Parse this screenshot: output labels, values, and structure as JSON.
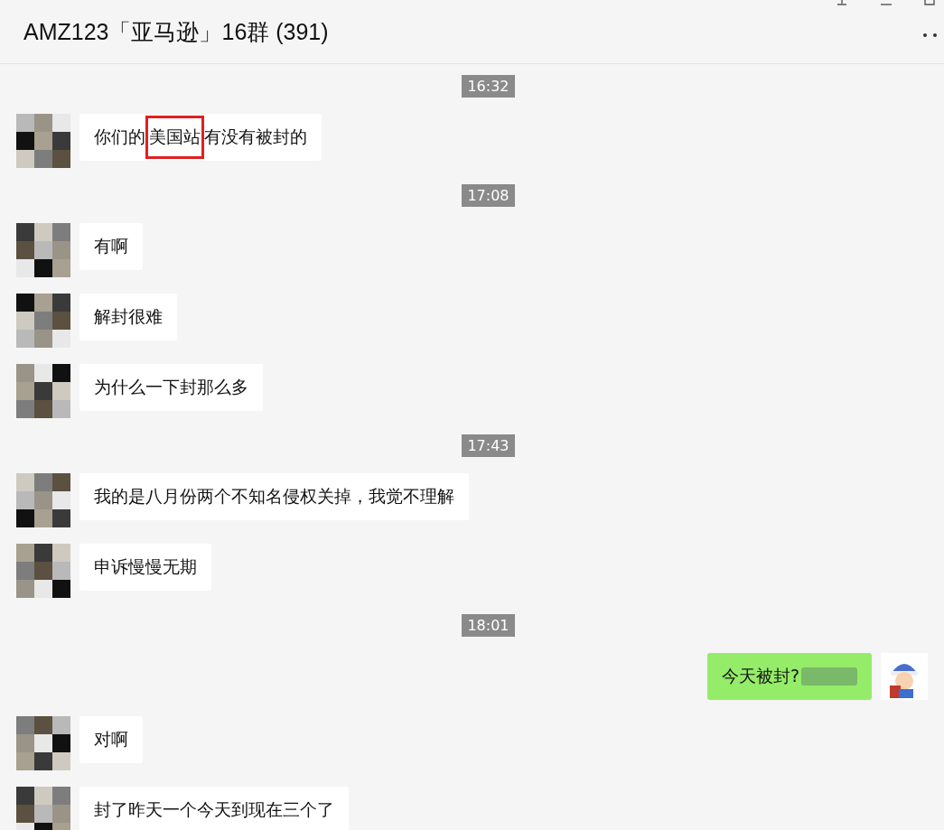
{
  "window": {
    "title": "AMZ123「亚马逊」16群 (391)"
  },
  "messages": [
    {
      "kind": "time",
      "text": "16:32"
    },
    {
      "kind": "message",
      "outgoing": false,
      "parts": [
        {
          "text": "你们的",
          "highlighted": false
        },
        {
          "text": "美国站",
          "highlighted": true
        },
        {
          "text": "有没有被封的",
          "highlighted": false
        }
      ]
    },
    {
      "kind": "time",
      "text": "17:08"
    },
    {
      "kind": "message",
      "outgoing": false,
      "parts": [
        {
          "text": "有啊",
          "highlighted": false
        }
      ]
    },
    {
      "kind": "message",
      "outgoing": false,
      "parts": [
        {
          "text": "解封很难",
          "highlighted": false
        }
      ]
    },
    {
      "kind": "message",
      "outgoing": false,
      "parts": [
        {
          "text": "为什么一下封那么多",
          "highlighted": false
        }
      ]
    },
    {
      "kind": "time",
      "text": "17:43"
    },
    {
      "kind": "message",
      "outgoing": false,
      "parts": [
        {
          "text": "我的是八月份两个不知名侵权关掉，我觉不理解",
          "highlighted": false
        }
      ]
    },
    {
      "kind": "message",
      "outgoing": false,
      "parts": [
        {
          "text": "申诉慢慢无期",
          "highlighted": false
        }
      ]
    },
    {
      "kind": "time",
      "text": "18:01"
    },
    {
      "kind": "message",
      "outgoing": true,
      "redacted": true,
      "parts": [
        {
          "text": "今天被封?",
          "highlighted": false
        }
      ]
    },
    {
      "kind": "message",
      "outgoing": false,
      "parts": [
        {
          "text": "对啊",
          "highlighted": false
        }
      ]
    },
    {
      "kind": "message",
      "outgoing": false,
      "parts": [
        {
          "text": "封了昨天一个今天到现在三个了",
          "highlighted": false
        }
      ]
    }
  ]
}
